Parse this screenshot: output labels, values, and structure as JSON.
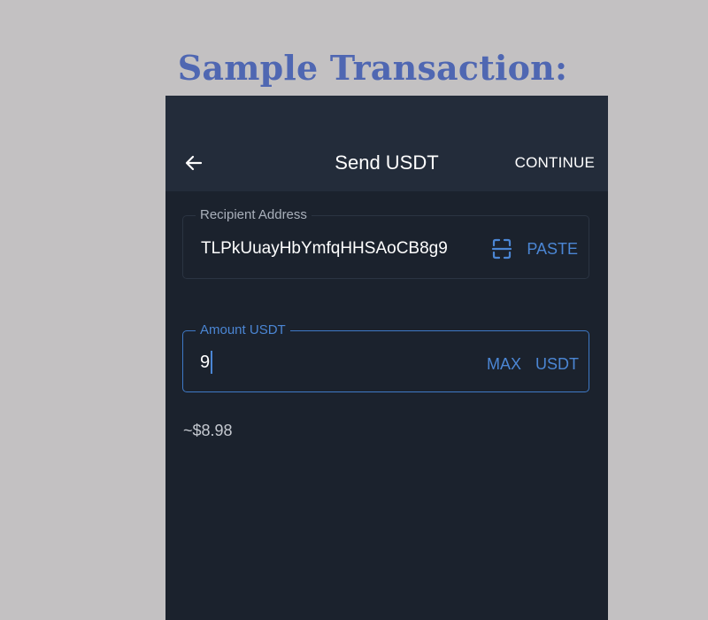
{
  "caption": {
    "text": "Sample Transaction:",
    "color": "#4f67b2"
  },
  "appbar": {
    "title": "Send USDT",
    "back_icon": "arrow-left-icon",
    "continue_label": "CONTINUE"
  },
  "recipient": {
    "label": "Recipient Address",
    "value": "TLPkUuayHbYmfqHHSAoCB8g9",
    "scan_icon": "qr-scan-icon",
    "paste_label": "PASTE"
  },
  "amount": {
    "label": "Amount USDT",
    "value": "9",
    "max_label": "MAX",
    "unit_label": "USDT"
  },
  "fiat_estimate": "~$8.98",
  "colors": {
    "background": "#c3c1c2",
    "screen": "#1b222d",
    "appbar": "#232c3a",
    "accent": "#4b86d4"
  }
}
